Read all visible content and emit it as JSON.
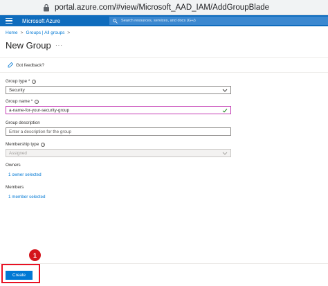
{
  "browser": {
    "url": "portal.azure.com/#view/Microsoft_AAD_IAM/AddGroupBlade"
  },
  "header": {
    "brand": "Microsoft Azure",
    "search_placeholder": "Search resources, services, and docs (G+/)"
  },
  "breadcrumb": {
    "items": [
      "Home",
      "Groups | All groups"
    ],
    "separator": ">"
  },
  "page": {
    "title": "New Group",
    "more_label": "···"
  },
  "toolbar": {
    "feedback_label": "Got feedback?"
  },
  "form": {
    "group_type": {
      "label": "Group type *",
      "value": "Security"
    },
    "group_name": {
      "label": "Group name *",
      "value": "a-name-for-your-security-group"
    },
    "group_description": {
      "label": "Group description",
      "placeholder": "Enter a description for the group"
    },
    "membership_type": {
      "label": "Membership type",
      "value": "Assigned"
    },
    "owners": {
      "label": "Owners",
      "link": "1 owner selected"
    },
    "members": {
      "label": "Members",
      "link": "1 member selected"
    }
  },
  "footer": {
    "create_label": "Create"
  },
  "annotation": {
    "step": "1"
  },
  "colors": {
    "azure_blue": "#0f6cbd",
    "primary": "#0078d4",
    "highlight_red": "#e81123",
    "focus_border": "#c239b3"
  }
}
